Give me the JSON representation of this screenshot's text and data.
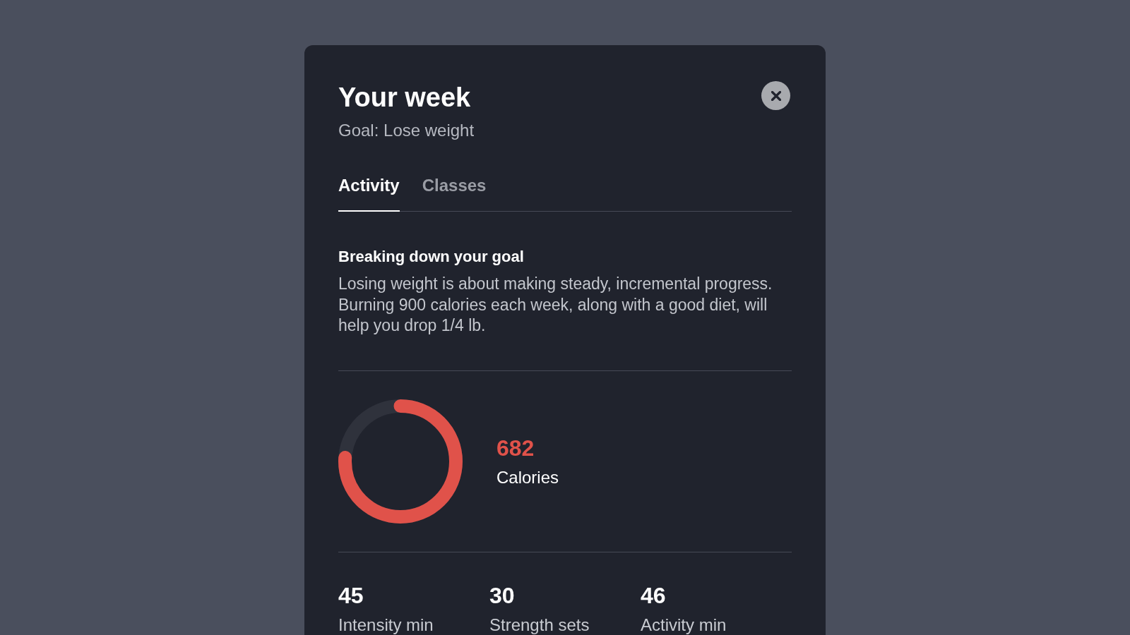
{
  "dialog": {
    "title": "Your week",
    "subtitle": "Goal: Lose weight",
    "tabs": [
      {
        "label": "Activity",
        "selected": true
      },
      {
        "label": "Classes",
        "selected": false
      }
    ],
    "section": {
      "heading": "Breaking down your goal",
      "body": "Losing weight is about making steady, incremental progress. Burning 900 calories each week, along with a good diet, will help you drop 1/4 lb."
    },
    "calories": {
      "value": "682",
      "label": "Calories",
      "level": 0.76
    },
    "stats": [
      {
        "value": "45",
        "label": "Intensity min"
      },
      {
        "value": "30",
        "label": "Strength sets"
      },
      {
        "value": "46",
        "label": "Activity min"
      }
    ]
  }
}
